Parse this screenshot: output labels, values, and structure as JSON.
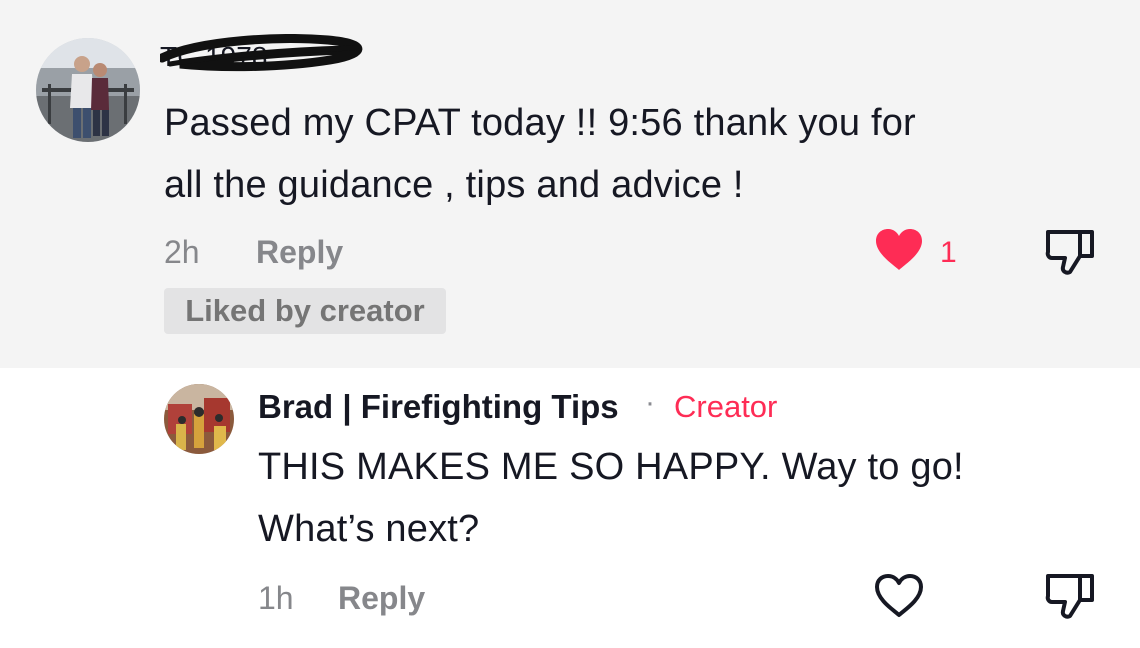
{
  "comment": {
    "username_redacted": "TC 1978",
    "text_line1": "Passed my CPAT today !! 9:56 thank you for",
    "text_line2": "all the guidance , tips and advice !",
    "time": "2h",
    "reply_label": "Reply",
    "like_count": "1",
    "liked": true,
    "badge": "Liked by creator",
    "like_color": "#fe2c55"
  },
  "reply": {
    "author": "Brad | Firefighting Tips",
    "separator": "·",
    "creator_tag": "Creator",
    "text_line1": "THIS MAKES ME SO HAPPY. Way to go!",
    "text_line2": "What’s next?",
    "time": "1h",
    "reply_label": "Reply",
    "liked": false
  },
  "icons": {
    "like": "heart-icon",
    "dislike": "thumbs-down-icon"
  }
}
